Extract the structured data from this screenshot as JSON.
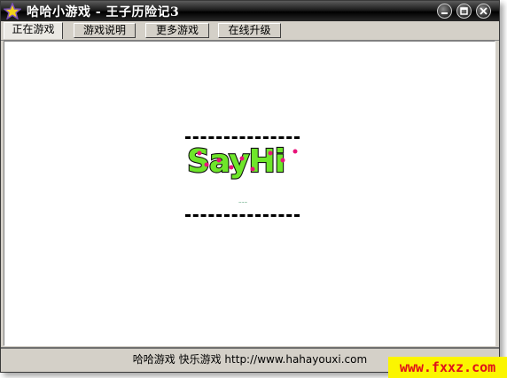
{
  "window": {
    "title": "哈哈小游戏 - 王子历险记3",
    "icons": {
      "app": "star-icon",
      "minimize": "minimize-icon",
      "maximize": "maximize-icon",
      "close": "close-icon"
    }
  },
  "tabs": [
    {
      "label": "正在游戏",
      "active": true
    },
    {
      "label": "游戏说明",
      "active": false
    },
    {
      "label": "更多游戏",
      "active": false
    },
    {
      "label": "在线升级",
      "active": false
    }
  ],
  "game": {
    "logo_text": "SayHi",
    "loading_text": "~~~"
  },
  "status": {
    "text": "哈哈游戏 快乐游戏 http://www.hahayouxi.com"
  },
  "watermark": {
    "text": "www.fxxz.com",
    "bg_color": "#fbf500",
    "text_color": "#e0101a"
  }
}
